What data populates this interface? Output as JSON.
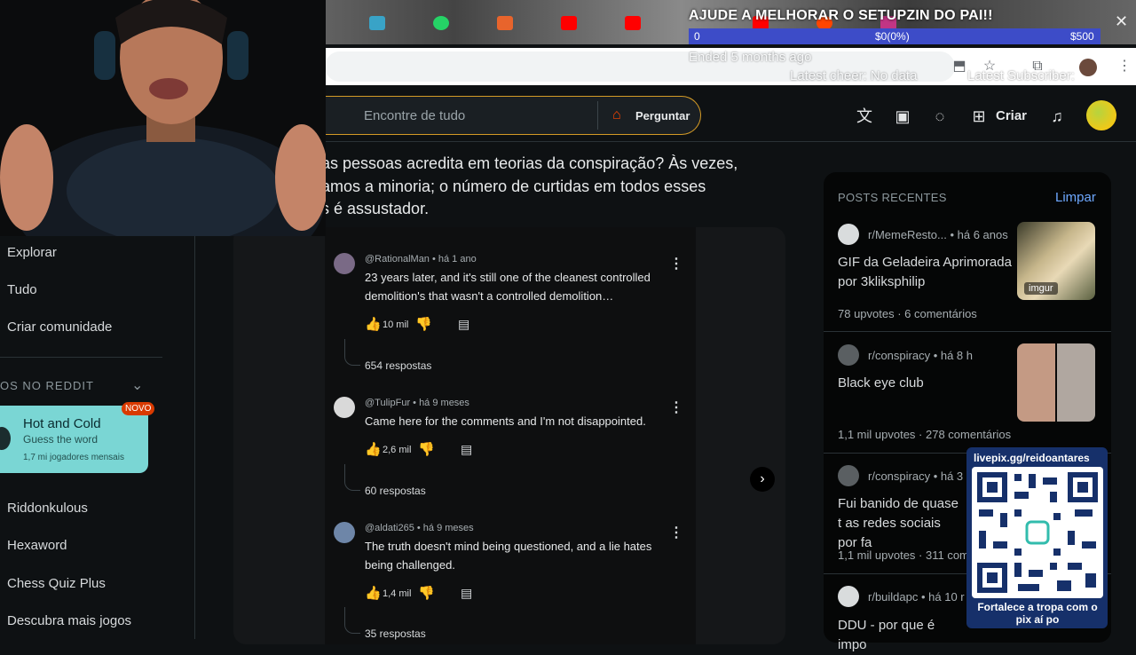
{
  "overlay": {
    "title": "AJUDE A MELHORAR O SETUPZIN DO PAI!!",
    "goal_start": "0",
    "goal_progress_text": "$0(0%)",
    "goal_target": "$500",
    "goal_progress_fraction": 0,
    "ended": "Ended 5 months ago",
    "latest_cheer": "Latest cheer: No data",
    "latest_subscriber": "Latest Subscriber:",
    "accent": "#3d4cc8"
  },
  "browser": {
    "close_symbol": "✕",
    "tab_icons": [
      "app-icon",
      "whatsapp-icon",
      "bookmark-icon",
      "youtube-icon",
      "youtube-icon",
      "youtube-icon",
      "reddit-icon",
      "instagram-icon"
    ]
  },
  "header": {
    "search_placeholder": "Encontre de tudo",
    "ask_label": "Perguntar",
    "create_label": "Criar"
  },
  "sidebar": {
    "items": [
      {
        "label": "Explorar"
      },
      {
        "label": "Tudo"
      },
      {
        "label": "Criar comunidade"
      }
    ],
    "section_title": "OS NO REDDIT",
    "featured_game": {
      "title": "Hot and Cold",
      "subtitle": "Guess the word",
      "players": "1,7 mi jogadores mensais",
      "badge": "NOVO"
    },
    "games": [
      {
        "label": "Riddonkulous"
      },
      {
        "label": "Hexaword"
      },
      {
        "label": "Chess Quiz Plus"
      },
      {
        "label": "Descubra mais jogos"
      }
    ]
  },
  "post": {
    "title_lines": [
      "as pessoas acredita em teorias da conspiração? Às vezes,",
      "amos a minoria; o número de curtidas em todos esses",
      "s é assustador."
    ]
  },
  "comments": [
    {
      "meta": "@RationalMan • há 1 ano",
      "text": "23 years later, and it's still one of the cleanest controlled demolition's that wasn't a controlled demolition…",
      "likes": "10 mil",
      "replies": "654 respostas"
    },
    {
      "meta": "@TulipFur • há 9 meses",
      "text": "Came here for the comments and I'm not disappointed.",
      "likes": "2,6 mil",
      "replies": "60 respostas"
    },
    {
      "meta": "@aldati265 • há 9 meses",
      "text": "The truth doesn't mind being questioned, and a lie hates being challenged.",
      "likes": "1,4 mil",
      "replies": "35 respostas"
    }
  ],
  "recent_posts": {
    "title": "POSTS RECENTES",
    "clear_label": "Limpar",
    "posts": [
      {
        "sub": "r/MemeResto... • há 6 anos",
        "title": "GIF da Geladeira Aprimorada por 3kliksphilip",
        "stats": "78 upvotes · 6 comentários",
        "thumb_label": "imgur"
      },
      {
        "sub": "r/conspiracy • há 8 h",
        "title": "Black eye club",
        "stats": "1,1 mil upvotes · 278 comentários"
      },
      {
        "sub": "r/conspiracy • há 3",
        "title": "Fui banido de quase t as redes sociais por fa",
        "stats": "1,1 mil upvotes · 311 com"
      },
      {
        "sub": "r/buildapc • há 10 r",
        "title": "DDU - por que é impo"
      }
    ]
  },
  "qr": {
    "url": "livepix.gg/reidoantares",
    "caption": "Fortalece a tropa com o pix aí po"
  }
}
